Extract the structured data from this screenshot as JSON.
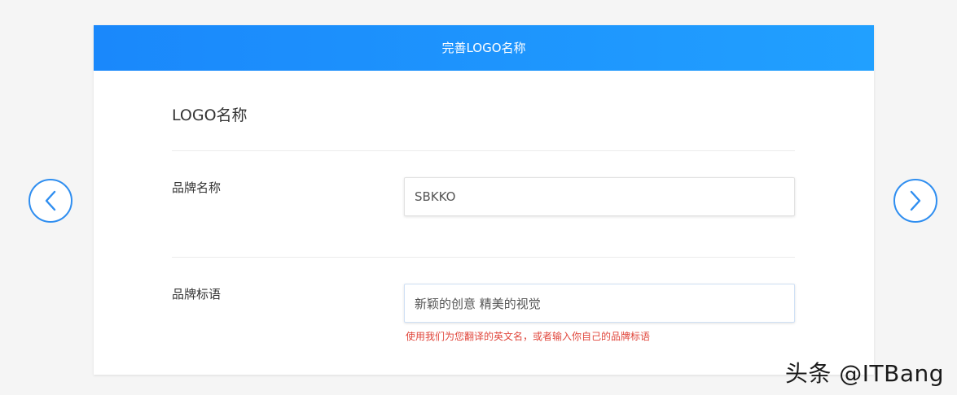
{
  "header": {
    "title": "完善LOGO名称"
  },
  "section": {
    "title": "LOGO名称"
  },
  "form": {
    "brand_name": {
      "label": "品牌名称",
      "value": "SBKKO"
    },
    "brand_slogan": {
      "label": "品牌标语",
      "value": "新颖的创意 精美的视觉",
      "hint": "使用我们为您翻译的英文名，或者输入你自己的品牌标语"
    }
  },
  "nav": {
    "prev_icon": "chevron-left-icon",
    "next_icon": "chevron-right-icon"
  },
  "watermark": {
    "text": "头条 @ITBang"
  },
  "colors": {
    "header_start": "#1a88fb",
    "header_end": "#21a0ff",
    "nav_accent": "#2f8ef0",
    "hint_error": "#e0463b"
  }
}
